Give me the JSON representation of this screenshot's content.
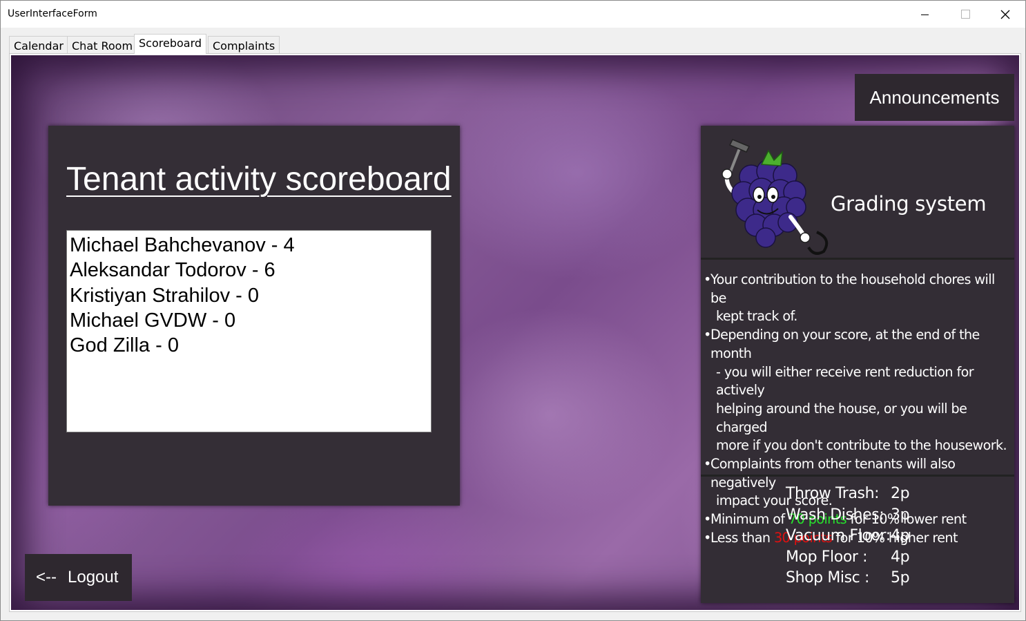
{
  "window": {
    "title": "UserInterfaceForm"
  },
  "tabs": [
    {
      "label": "Calendar"
    },
    {
      "label": "Chat Room"
    },
    {
      "label": "Scoreboard",
      "active": true
    },
    {
      "label": "Complaints"
    }
  ],
  "scoreboard": {
    "title": "Tenant activity scoreboard",
    "entries": [
      "Michael Bahchevanov - 4",
      "Aleksandar Todorov - 6",
      "Kristiyan Strahilov - 0",
      "Michael GVDW - 0",
      "God Zilla - 0"
    ]
  },
  "logout": {
    "arrow": "<--",
    "label": "Logout"
  },
  "announcements": {
    "label": "Announcements"
  },
  "grading": {
    "title": "Grading system",
    "rules": {
      "r1_line1": "Your contribution to the household  chores will be",
      "r1_line2": "kept track of.",
      "r2_line1": "Depending on your score, at the end of the month",
      "r2_line2": "- you will either receive rent reduction for actively",
      "r2_line3": "helping around the house, or you will be charged",
      "r2_line4": "more if you don't contribute to the housework.",
      "r3_line1": "Complaints from other tenants will also negatively",
      "r3_line2": "impact your score.",
      "r4_prefix": "Minimum of ",
      "r4_highlight": "70 points",
      "r4_suffix": " for 10% lower rent",
      "r5_prefix": "Less than ",
      "r5_highlight": "30 points",
      "r5_suffix": " for 10% higher rent"
    },
    "points": [
      {
        "task": "Throw Trash:",
        "value": "2p"
      },
      {
        "task": "Wash Dishes:",
        "value": "3p"
      },
      {
        "task": "Vacuum Floor:",
        "value": "4p"
      },
      {
        "task": "Mop Floor :",
        "value": "4p"
      },
      {
        "task": "Shop Misc :",
        "value": "5p"
      }
    ]
  },
  "colors": {
    "panel": "#342e36",
    "button": "#2e282f",
    "highlight_good": "#27e02d",
    "highlight_bad": "#e01010",
    "icons": [
      "minimize-icon",
      "maximize-icon",
      "close-icon",
      "grape-mascot-icon"
    ]
  }
}
